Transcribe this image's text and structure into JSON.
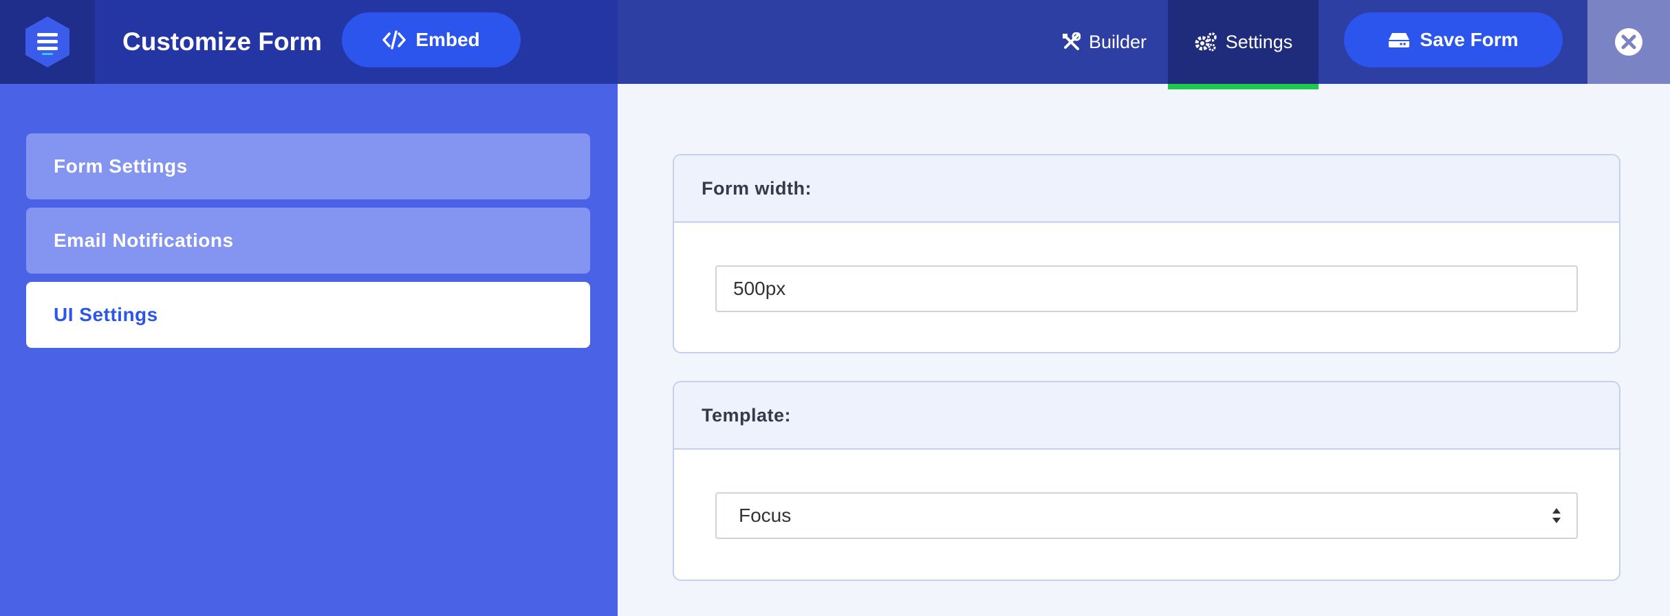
{
  "header": {
    "title": "Customize Form",
    "embed_label": "Embed",
    "tabs": [
      {
        "label": "Builder",
        "icon": "tools-icon"
      },
      {
        "label": "Settings",
        "icon": "gears-icon",
        "active": true
      }
    ],
    "save_label": "Save Form"
  },
  "sidebar": {
    "items": [
      {
        "label": "Form Settings"
      },
      {
        "label": "Email Notifications"
      },
      {
        "label": "UI Settings",
        "active": true
      }
    ]
  },
  "main": {
    "form_width": {
      "label": "Form width:",
      "value": "500px"
    },
    "template": {
      "label": "Template:",
      "selected": "Focus"
    }
  },
  "colors": {
    "accent": "#2c55ee",
    "sidebar_bg": "#4a63e6",
    "header_bg": "#2e3fa3",
    "active_tab_indicator": "#1ec94c"
  }
}
